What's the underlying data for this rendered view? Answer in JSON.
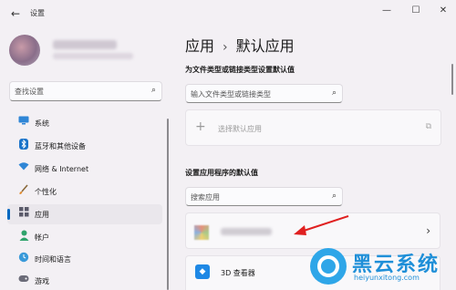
{
  "window": {
    "title": "设置",
    "controls": {
      "minimize": "—",
      "maximize": "☐",
      "close": "✕"
    }
  },
  "search": {
    "placeholder": "查找设置"
  },
  "sidebar": {
    "items": [
      {
        "label": "系统",
        "icon": "monitor-icon"
      },
      {
        "label": "蓝牙和其他设备",
        "icon": "bluetooth-icon"
      },
      {
        "label": "网络 & Internet",
        "icon": "wifi-icon"
      },
      {
        "label": "个性化",
        "icon": "brush-icon"
      },
      {
        "label": "应用",
        "icon": "apps-icon",
        "active": true
      },
      {
        "label": "帐户",
        "icon": "person-icon"
      },
      {
        "label": "时间和语言",
        "icon": "globe-clock-icon"
      },
      {
        "label": "游戏",
        "icon": "gamepad-icon"
      }
    ]
  },
  "main": {
    "breadcrumb": {
      "parent": "应用",
      "separator": "›",
      "current": "默认应用"
    },
    "file_type_section": {
      "title": "为文件类型或链接类型设置默认值",
      "placeholder": "输入文件类型或链接类型"
    },
    "choose_default": {
      "label": "选择默认应用"
    },
    "app_section": {
      "title": "设置应用程序的默认值",
      "placeholder": "搜索应用"
    },
    "apps": [
      {
        "name": "3D 查看器",
        "icon": "cube-3d-icon"
      }
    ]
  },
  "watermark": {
    "text": "黑云系统",
    "url": "heiyunxitong.com"
  },
  "colors": {
    "accent": "#0067c0",
    "watermark": "#1f8fd8"
  }
}
